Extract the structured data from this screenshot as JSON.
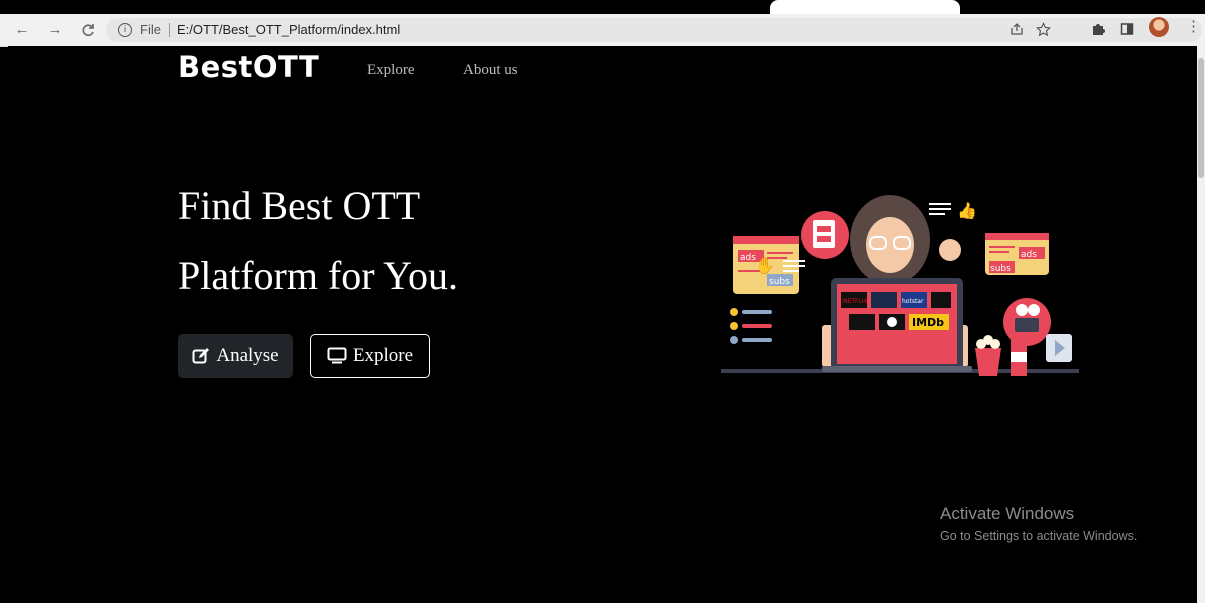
{
  "browser": {
    "back_icon": "←",
    "forward_icon": "→",
    "reload_icon": "C",
    "info_icon": "ⓘ",
    "scheme_label": "File",
    "url": "E:/OTT/Best_OTT_Platform/index.html"
  },
  "nav": {
    "brand": "BestOTT",
    "links": [
      "Explore",
      "About us"
    ]
  },
  "hero": {
    "line1": "Find Best OTT",
    "line2": "Platform for You."
  },
  "buttons": {
    "analyse": "Analyse",
    "explore": "Explore"
  },
  "illustration": {
    "logos": [
      "NETFLIX",
      "hotstar",
      "IMDb"
    ],
    "ads_label": "ads",
    "subs_label": "subs",
    "colors": {
      "accent": "#e8495a",
      "yellow": "#f7c433",
      "laptop": "#3b3f52"
    }
  },
  "watermark": {
    "title": "Activate Windows",
    "subtitle": "Go to Settings to activate Windows."
  }
}
